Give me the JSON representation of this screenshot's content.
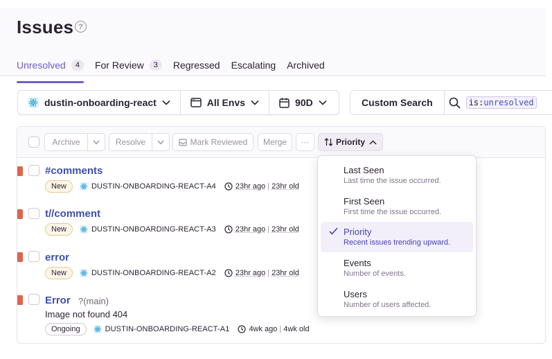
{
  "page": {
    "title": "Issues",
    "help_icon": "?"
  },
  "tabs": [
    {
      "label": "Unresolved",
      "count": "4",
      "active": true
    },
    {
      "label": "For Review",
      "count": "3"
    },
    {
      "label": "Regressed"
    },
    {
      "label": "Escalating"
    },
    {
      "label": "Archived"
    }
  ],
  "filters": {
    "project": "dustin-onboarding-react",
    "env": "All Envs",
    "date": "90D"
  },
  "search": {
    "label": "Custom Search",
    "token_key": "is:",
    "token_value": "unresolved"
  },
  "actions": {
    "archive": "Archive",
    "resolve": "Resolve",
    "mark_reviewed": "Mark Reviewed",
    "merge": "Merge",
    "more": "···",
    "sort": "Priority"
  },
  "issues": [
    {
      "title": "#comments",
      "badge": "New",
      "project": "DUSTIN-ONBOARDING-REACT-A4",
      "last_seen": "23hr ago",
      "age": "23hr old"
    },
    {
      "title": "t//comment",
      "badge": "New",
      "project": "DUSTIN-ONBOARDING-REACT-A3",
      "last_seen": "23hr ago",
      "age": "23hr old"
    },
    {
      "title": "error",
      "badge": "New",
      "project": "DUSTIN-ONBOARDING-REACT-A2",
      "last_seen": "23hr ago",
      "age": "23hr old"
    },
    {
      "title": "Error",
      "subtitle": "?(main)",
      "message": "Image not found 404",
      "badge": "Ongoing",
      "project": "DUSTIN-ONBOARDING-REACT-A1",
      "last_seen": "4wk ago",
      "age": "4wk old"
    }
  ],
  "sort_menu": [
    {
      "label": "Last Seen",
      "desc": "Last time the issue occurred."
    },
    {
      "label": "First Seen",
      "desc": "First time the issue occurred."
    },
    {
      "label": "Priority",
      "desc": "Recent issues trending upward.",
      "selected": true
    },
    {
      "label": "Events",
      "desc": "Number of events."
    },
    {
      "label": "Users",
      "desc": "Number of users affected."
    }
  ],
  "colors": {
    "accent": "#6c5fc7",
    "link": "#3d4fb0",
    "marker": "#e0644a"
  }
}
